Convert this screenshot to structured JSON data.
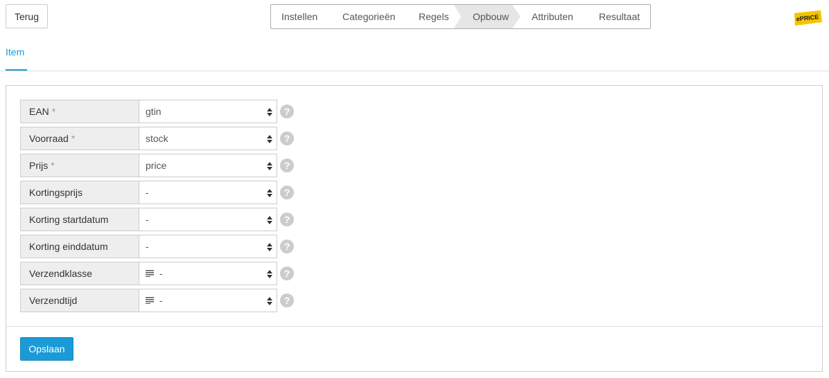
{
  "header": {
    "back_label": "Terug",
    "steps": [
      "Instellen",
      "Categorieën",
      "Regels",
      "Opbouw",
      "Attributen",
      "Resultaat"
    ],
    "active_step": "Opbouw",
    "logo_text": "ePRICE"
  },
  "tabs": {
    "item_label": "Item"
  },
  "form": {
    "required_mark": "*",
    "help_glyph": "?",
    "rows": [
      {
        "label": "EAN",
        "required": true,
        "value": "gtin"
      },
      {
        "label": "Voorraad",
        "required": true,
        "value": "stock"
      },
      {
        "label": "Prijs",
        "required": true,
        "value": "price"
      },
      {
        "label": "Kortingsprijs",
        "required": false,
        "value": "-"
      },
      {
        "label": "Korting startdatum",
        "required": false,
        "value": "-"
      },
      {
        "label": "Korting einddatum",
        "required": false,
        "value": "-"
      },
      {
        "label": "Verzendklasse",
        "required": false,
        "value": "-",
        "icon": "text-lines-icon"
      },
      {
        "label": "Verzendtijd",
        "required": false,
        "value": "-",
        "icon": "text-lines-icon"
      }
    ]
  },
  "footer": {
    "save_label": "Opslaan"
  },
  "colors": {
    "accent": "#1a9bd7",
    "logo_yellow": "#f5c400",
    "active_step_bg": "#e6e6e6"
  }
}
